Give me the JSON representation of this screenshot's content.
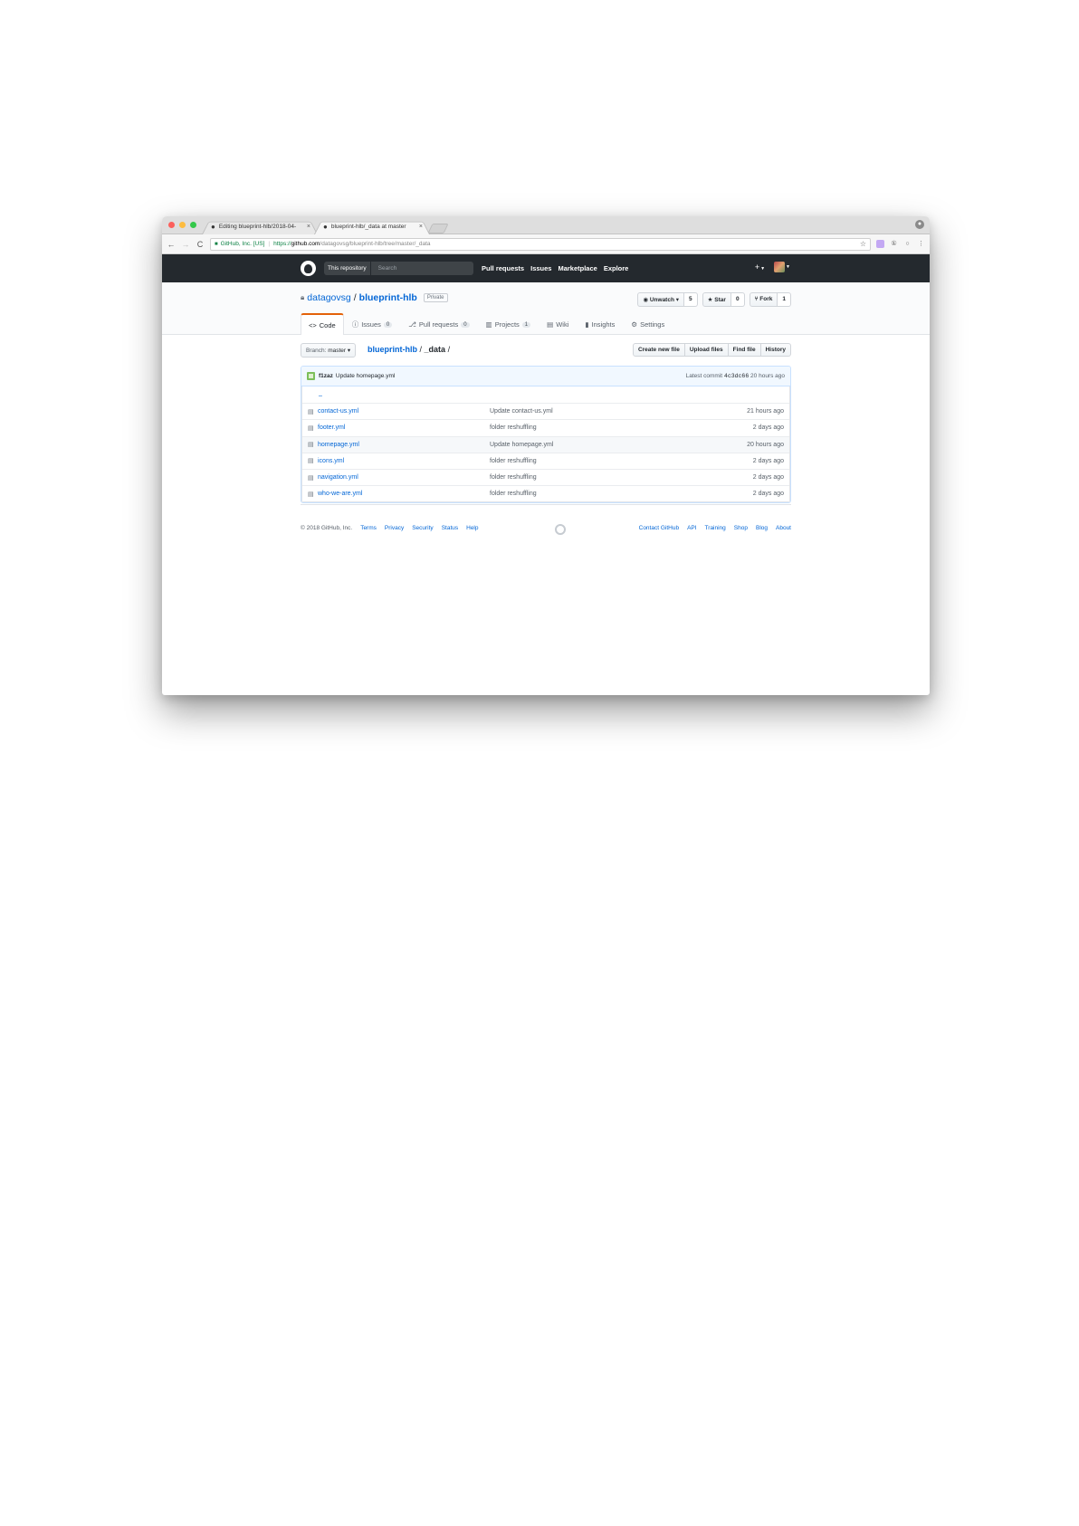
{
  "browser": {
    "tabs": [
      {
        "title": "Editing blueprint-hlb/2018-04-",
        "active": false
      },
      {
        "title": "blueprint-hlb/_data at master ",
        "active": true
      }
    ],
    "address": {
      "cert": "GitHub, Inc. [US]",
      "scheme": "https://",
      "host": "github.com",
      "path": "/datagovsg/blueprint-hlb/tree/master/_data"
    }
  },
  "header": {
    "search_scope": "This repository",
    "search_placeholder": "Search",
    "nav": [
      "Pull requests",
      "Issues",
      "Marketplace",
      "Explore"
    ],
    "plus_icon": "+"
  },
  "repo": {
    "owner": "datagovsg",
    "separator": "/",
    "name": "blueprint-hlb",
    "visibility": "Private",
    "actions": {
      "watch": {
        "label": "Unwatch",
        "count": "5"
      },
      "star": {
        "label": "Star",
        "count": "0"
      },
      "fork": {
        "label": "Fork",
        "count": "1"
      }
    },
    "tabs": [
      {
        "label": "Code",
        "icon": "<>",
        "counter": null
      },
      {
        "label": "Issues",
        "icon": "ⓘ",
        "counter": "0"
      },
      {
        "label": "Pull requests",
        "icon": "⎇",
        "counter": "0"
      },
      {
        "label": "Projects",
        "icon": "▥",
        "counter": "1"
      },
      {
        "label": "Wiki",
        "icon": "▤",
        "counter": null
      },
      {
        "label": "Insights",
        "icon": "▮",
        "counter": null
      },
      {
        "label": "Settings",
        "icon": "⚙",
        "counter": null
      }
    ]
  },
  "filenav": {
    "branch_label": "Branch:",
    "branch": "master",
    "crumb_root": "blueprint-hlb",
    "crumb_sep": "/",
    "crumb_current": "_data",
    "crumb_trail": "/",
    "buttons": [
      "Create new file",
      "Upload files",
      "Find file",
      "History"
    ]
  },
  "commit": {
    "author": "f1zaz",
    "message": "Update homepage.yml",
    "latest_label": "Latest commit",
    "sha": "4c3dc66",
    "age": "20 hours ago"
  },
  "files": {
    "updir": "..",
    "rows": [
      {
        "name": "contact-us.yml",
        "message": "Update contact-us.yml",
        "age": "21 hours ago"
      },
      {
        "name": "footer.yml",
        "message": "folder reshuffling",
        "age": "2 days ago"
      },
      {
        "name": "homepage.yml",
        "message": "Update homepage.yml",
        "age": "20 hours ago"
      },
      {
        "name": "icons.yml",
        "message": "folder reshuffling",
        "age": "2 days ago"
      },
      {
        "name": "navigation.yml",
        "message": "folder reshuffling",
        "age": "2 days ago"
      },
      {
        "name": "who-we-are.yml",
        "message": "folder reshuffling",
        "age": "2 days ago"
      }
    ]
  },
  "footer": {
    "copyright": "© 2018 GitHub, Inc.",
    "left_links": [
      "Terms",
      "Privacy",
      "Security",
      "Status",
      "Help"
    ],
    "right_links": [
      "Contact GitHub",
      "API",
      "Training",
      "Shop",
      "Blog",
      "About"
    ]
  }
}
